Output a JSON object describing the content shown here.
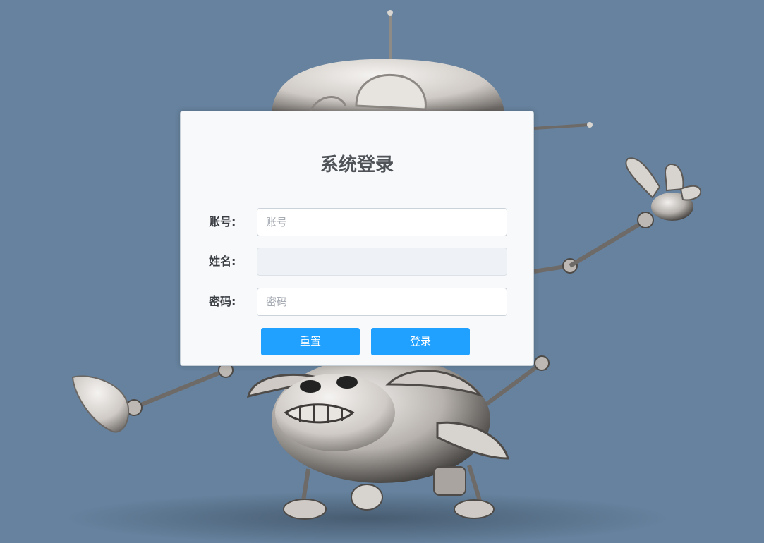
{
  "login": {
    "title": "系统登录",
    "account_label": "账号:",
    "account_placeholder": "账号",
    "account_value": "",
    "name_label": "姓名:",
    "name_value": "",
    "password_label": "密码:",
    "password_placeholder": "密码",
    "password_value": "",
    "reset_button": "重置",
    "login_button": "登录"
  },
  "colors": {
    "background": "#66829e",
    "panel": "#f7f9fb",
    "primary_button": "#20a0ff",
    "title_text": "#505458"
  },
  "icons": {
    "background_art": "robot-illustration"
  }
}
